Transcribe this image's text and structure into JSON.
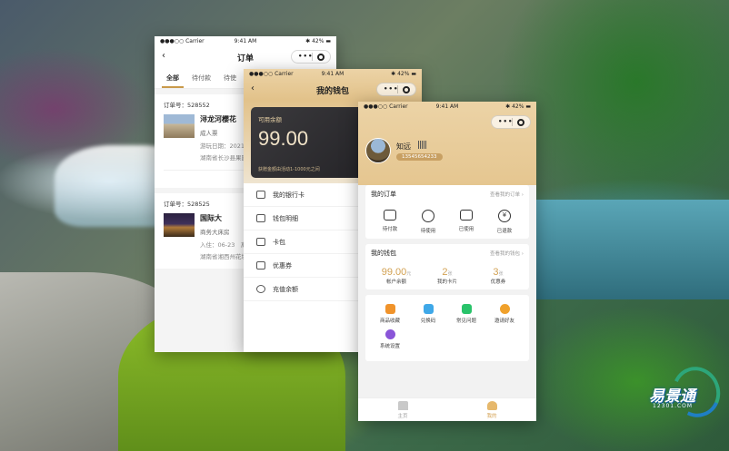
{
  "colors": {
    "accent": "#d2a152",
    "header_gold": "#e5c690",
    "card_dark": "#2a292d"
  },
  "status_bar": {
    "carrier": "●●●○○ Carrier",
    "time": "9:41 AM",
    "battery": "✱ 42% ▬"
  },
  "capsule": {
    "more": "•••"
  },
  "orders_screen": {
    "title": "订单",
    "tabs": [
      "全部",
      "待付款",
      "待使"
    ],
    "orders": [
      {
        "order_no": "订单号：528552",
        "name": "浔龙河樱花",
        "tag": "成人票",
        "date": "游玩日期：2021-06-16",
        "address": "湖南省长沙县果园镇浔龙河"
      },
      {
        "order_no": "订单号：528525",
        "name": "国际大",
        "tag": "商务大床房",
        "date": "入住：06-23　离店：06-2",
        "address": "湖南省湘西州花垣县双龙"
      }
    ]
  },
  "wallet_screen": {
    "title": "我的钱包",
    "balance_label": "可用余额",
    "balance": "99.00",
    "note": "获赠金额由活动1-1000元之间",
    "menu": [
      "我的银行卡",
      "钱包明细",
      "卡包",
      "优惠券",
      "充值余额"
    ]
  },
  "profile_screen": {
    "user_name": "知远",
    "phone": "13545654233",
    "orders_section": {
      "title": "我的订单",
      "more": "查看我的订单 ›",
      "items": [
        {
          "label": "待付款",
          "icon": "wallet-icon"
        },
        {
          "label": "待使用",
          "icon": "camera-icon"
        },
        {
          "label": "已使用",
          "icon": "envelope-icon"
        },
        {
          "label": "已退款",
          "icon": "yen-icon"
        }
      ]
    },
    "wallet_section": {
      "title": "我的钱包",
      "more": "查看我的钱包 ›",
      "stats": [
        {
          "value": "99.00",
          "unit": "元",
          "label": "帐户余额"
        },
        {
          "value": "2",
          "unit": "张",
          "label": "我的卡片"
        },
        {
          "value": "3",
          "unit": "张",
          "label": "优惠券"
        }
      ]
    },
    "tools": [
      {
        "label": "商品收藏",
        "icon": "collection-icon",
        "color": "#f0932b"
      },
      {
        "label": "兑换码",
        "icon": "redeem-code-icon",
        "color": "#3fa8e8"
      },
      {
        "label": "常见问题",
        "icon": "faq-icon",
        "color": "#29c36a"
      },
      {
        "label": "邀请好友",
        "icon": "invite-friend-icon",
        "color": "#f0a12b"
      },
      {
        "label": "系统设置",
        "icon": "settings-icon",
        "color": "#8a55d8"
      }
    ],
    "tabbar": [
      "主页",
      "我的"
    ]
  },
  "logo": {
    "brand": "易景通",
    "domain": "12301.COM"
  }
}
